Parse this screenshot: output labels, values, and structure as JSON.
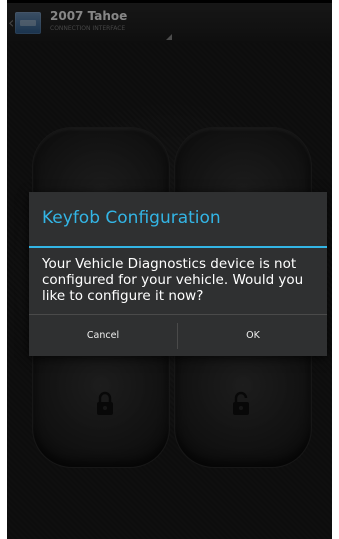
{
  "action_bar": {
    "vehicle_name": "2007 Tahoe",
    "vehicle_subtitle": "CONNECTION INTERFACE",
    "icons": [
      "back-chevron-icon",
      "app-icon",
      "spinner-arrow-icon"
    ]
  },
  "dialog": {
    "title": "Keyfob Configuration",
    "message": "Your Vehicle Diagnostics device is not configured for your vehicle. Would you like to configure it now?",
    "cancel_label": "Cancel",
    "ok_label": "OK",
    "accent_color": "#33b5e5"
  },
  "keyfob": {
    "buttons": [
      "lock-button",
      "unlock-button",
      "lock-button-left",
      "unlock-button-right"
    ],
    "icons": [
      "lock-icon",
      "unlock-icon"
    ]
  }
}
